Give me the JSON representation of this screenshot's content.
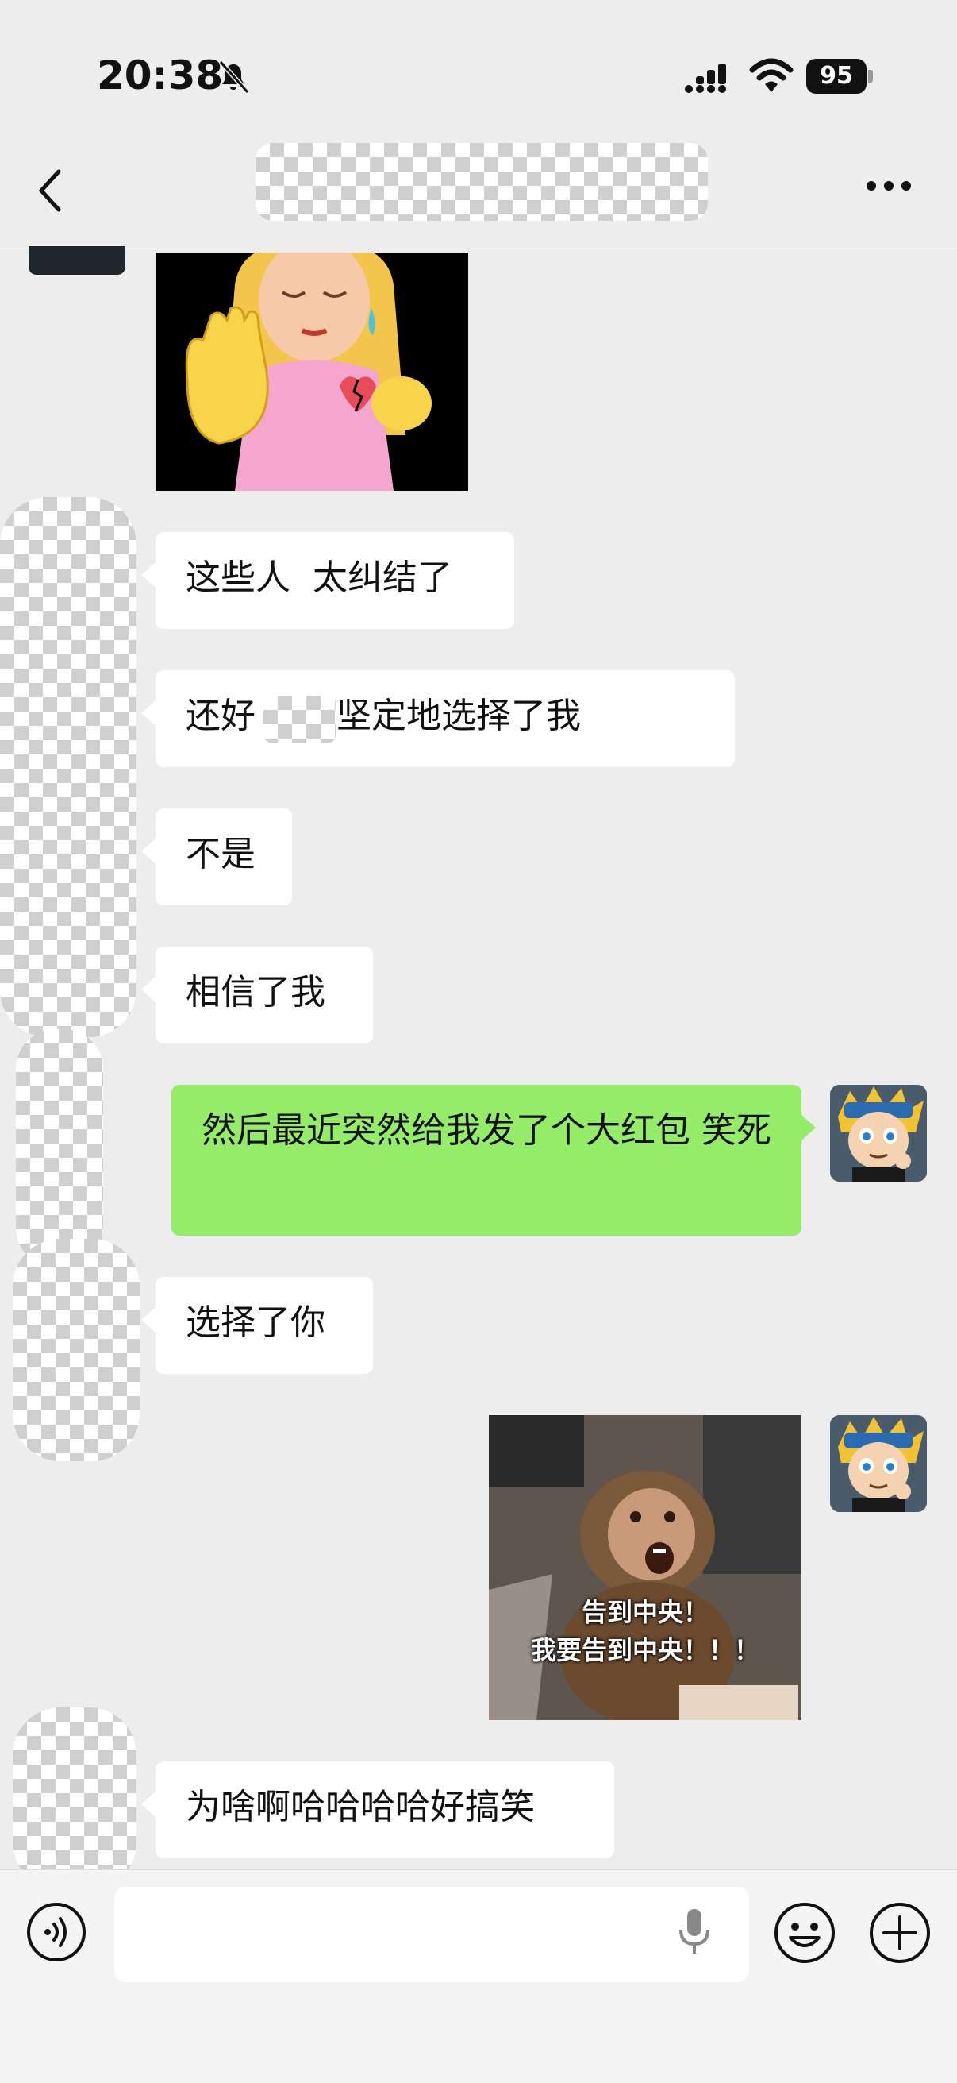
{
  "status_bar": {
    "time": "20:38",
    "battery": "95",
    "icons": [
      "bell-slash-icon",
      "signal-icon",
      "wifi-icon",
      "battery-icon"
    ]
  },
  "header": {
    "back_icon": "chevron-left-icon",
    "more_icon": "more-dots-icon"
  },
  "messages": [
    {
      "side": "in",
      "type": "sticker"
    },
    {
      "side": "in",
      "type": "text",
      "text": "这些人  太纠结了"
    },
    {
      "side": "in",
      "type": "text",
      "text": "还好 她们坚定地选择了我"
    },
    {
      "side": "in",
      "type": "text",
      "text": "不是"
    },
    {
      "side": "in",
      "type": "text",
      "text": "相信了我"
    },
    {
      "side": "out",
      "type": "text",
      "text": "然后最近突然给我发了个大红包 笑死"
    },
    {
      "side": "in",
      "type": "text",
      "text": "选择了你"
    },
    {
      "side": "out",
      "type": "sticker",
      "caption_line1": "告到中央！",
      "caption_line2": "我要告到中央！！！"
    },
    {
      "side": "in",
      "type": "text",
      "text": "为啥啊哈哈哈哈好搞笑"
    }
  ],
  "input_bar": {
    "value": "",
    "placeholder": "",
    "icons": [
      "voice-icon",
      "microphone-icon",
      "emoji-icon",
      "plus-icon"
    ]
  },
  "colors": {
    "background": "#EDEDED",
    "incoming_bubble": "#FFFFFF",
    "outgoing_bubble": "#95EC69"
  }
}
